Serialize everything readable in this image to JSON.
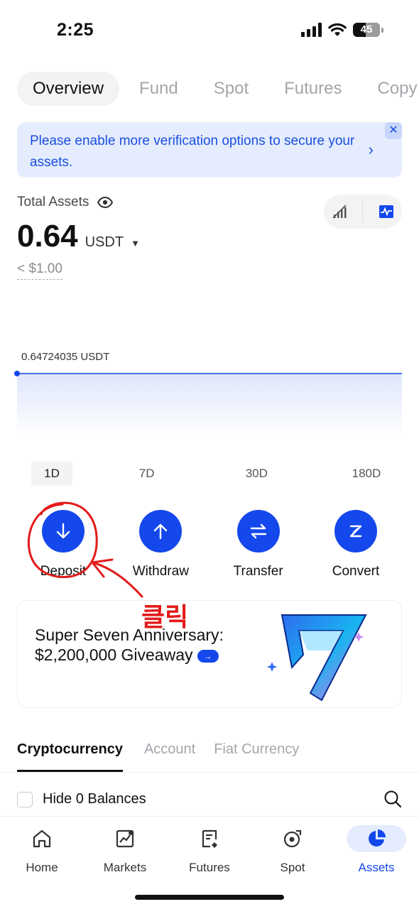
{
  "status": {
    "time": "2:25",
    "battery": "45"
  },
  "tabs": [
    {
      "label": "Overview"
    },
    {
      "label": "Fund"
    },
    {
      "label": "Spot"
    },
    {
      "label": "Futures"
    },
    {
      "label": "Copy"
    }
  ],
  "banner": {
    "text": "Please enable more verification options to secure your assets.",
    "close": "✕",
    "chevron": "›"
  },
  "total": {
    "label": "Total Assets",
    "value": "0.64",
    "unit": "USDT",
    "caret": "▼",
    "usd": "< $1.00"
  },
  "chart_data": {
    "type": "area",
    "label": "0.64724035 USDT",
    "values": [
      0.64724035,
      0.64724035
    ],
    "color": "#1448ec"
  },
  "periods": [
    {
      "label": "1D"
    },
    {
      "label": "7D"
    },
    {
      "label": "30D"
    },
    {
      "label": "180D"
    }
  ],
  "actions": [
    {
      "label": "Deposit",
      "icon": "arrow-down-icon"
    },
    {
      "label": "Withdraw",
      "icon": "arrow-up-icon"
    },
    {
      "label": "Transfer",
      "icon": "transfer-icon"
    },
    {
      "label": "Convert",
      "icon": "convert-icon"
    }
  ],
  "annotation": {
    "text": "클릭",
    "color": "#e31b1b"
  },
  "promo": {
    "title": "Super Seven Anniversary: $2,200,000 Giveaway",
    "arrow": "→"
  },
  "asset_tabs": [
    {
      "label": "Cryptocurrency"
    },
    {
      "label": "Account"
    },
    {
      "label": "Fiat Currency"
    }
  ],
  "hide_zero": {
    "label": "Hide 0 Balances"
  },
  "nav": [
    {
      "label": "Home",
      "icon": "home-icon"
    },
    {
      "label": "Markets",
      "icon": "markets-icon"
    },
    {
      "label": "Futures",
      "icon": "futures-icon"
    },
    {
      "label": "Spot",
      "icon": "spot-icon"
    },
    {
      "label": "Assets",
      "icon": "assets-icon"
    }
  ],
  "colors": {
    "accent": "#1448ec",
    "banner_bg": "#e4ecfd"
  }
}
